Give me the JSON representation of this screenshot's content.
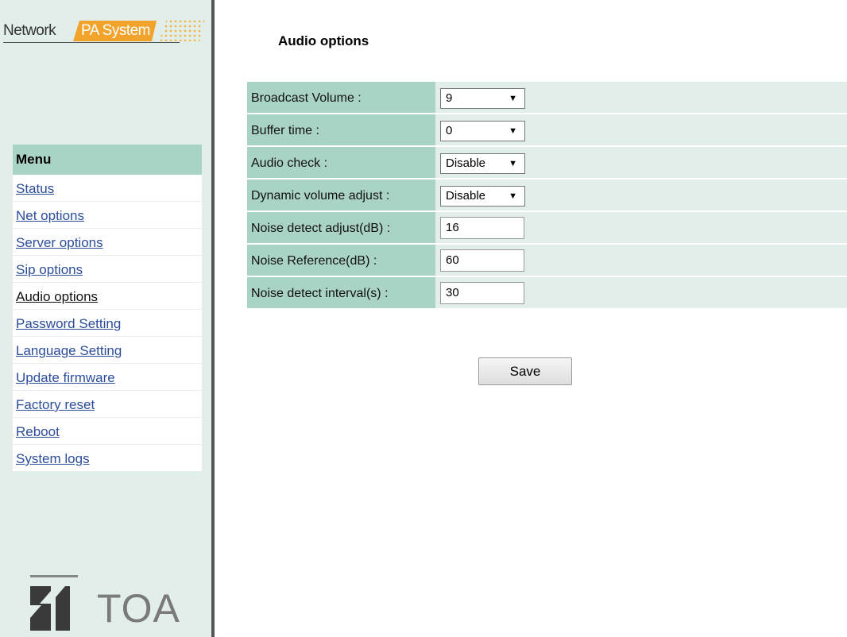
{
  "brand": {
    "network": "Network",
    "pa_system": "PA System"
  },
  "menu": {
    "title": "Menu",
    "items": [
      {
        "label": "Status"
      },
      {
        "label": "Net options"
      },
      {
        "label": "Server options"
      },
      {
        "label": "Sip options"
      },
      {
        "label": "Audio options",
        "current": true
      },
      {
        "label": "Password Setting"
      },
      {
        "label": "Language Setting"
      },
      {
        "label": "Update firmware"
      },
      {
        "label": "Factory reset"
      },
      {
        "label": "Reboot"
      },
      {
        "label": "System logs"
      }
    ]
  },
  "logo": {
    "text": "TOA",
    "color": "#7a7a7a"
  },
  "page": {
    "title": "Audio options"
  },
  "options": [
    {
      "label": "Broadcast Volume :",
      "type": "select",
      "value": "9"
    },
    {
      "label": "Buffer time :",
      "type": "select",
      "value": "0"
    },
    {
      "label": "Audio check :",
      "type": "select",
      "value": "Disable"
    },
    {
      "label": "Dynamic volume adjust :",
      "type": "select",
      "value": "Disable"
    },
    {
      "label": "Noise detect adjust(dB) :",
      "type": "input",
      "value": "16"
    },
    {
      "label": "Noise Reference(dB) :",
      "type": "input",
      "value": "60"
    },
    {
      "label": "Noise detect interval(s) :",
      "type": "input",
      "value": "30"
    }
  ],
  "actions": {
    "save_label": "Save"
  },
  "colors": {
    "label_bg": "#a9d3c4",
    "row_bg": "#e1eeea",
    "link": "#2b4d9a",
    "brand_orange": "#f1a32c"
  }
}
